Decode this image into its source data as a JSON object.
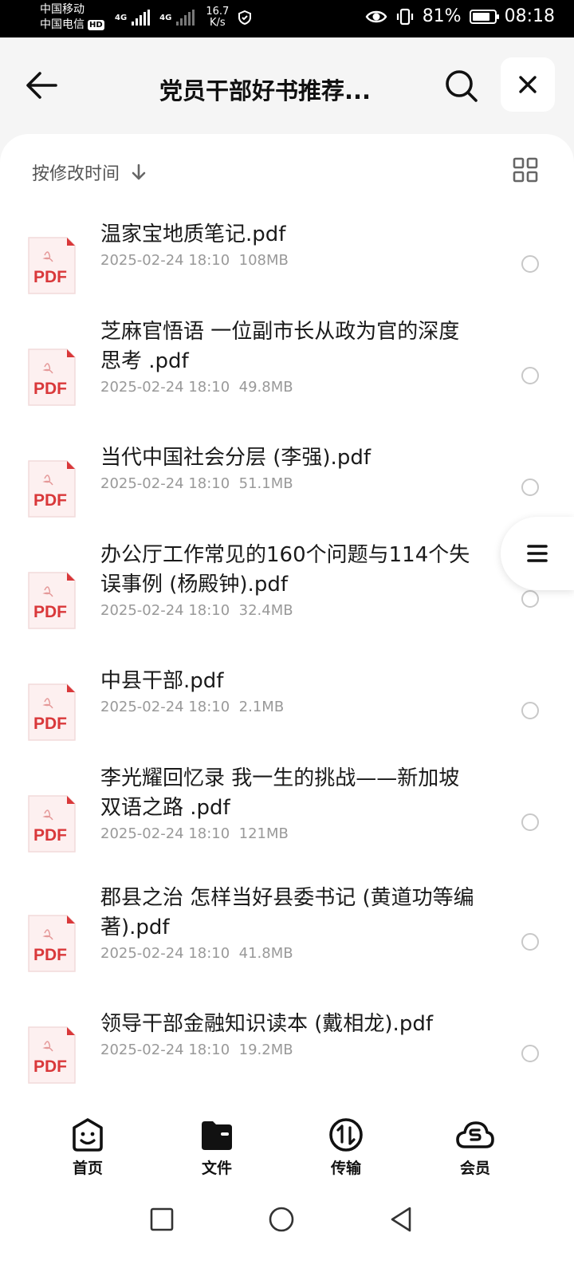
{
  "status_bar": {
    "carrier1": "中国移动",
    "carrier2": "中国电信",
    "hd": "HD",
    "net_type": "4G",
    "net_type2": "4G",
    "speed_value": "16.7",
    "speed_unit": "K/s",
    "battery": "81%",
    "battery_level": 0.81,
    "time": "08:18"
  },
  "header": {
    "title": "党员干部好书推荐..."
  },
  "sort": {
    "label": "按修改时间"
  },
  "files": [
    {
      "name": "温家宝地质笔记.pdf",
      "date": "2025-02-24 18:10",
      "size": "108MB"
    },
    {
      "name": "芝麻官悟语 一位副市长从政为官的深度思考 .pdf",
      "date": "2025-02-24 18:10",
      "size": "49.8MB"
    },
    {
      "name": "当代中国社会分层 (李强).pdf",
      "date": "2025-02-24 18:10",
      "size": "51.1MB"
    },
    {
      "name": "办公厅工作常见的160个问题与114个失误事例 (杨殿钟).pdf",
      "date": "2025-02-24 18:10",
      "size": "32.4MB"
    },
    {
      "name": "中县干部.pdf",
      "date": "2025-02-24 18:10",
      "size": "2.1MB"
    },
    {
      "name": "李光耀回忆录 我一生的挑战——新加坡双语之路 .pdf",
      "date": "2025-02-24 18:10",
      "size": "121MB"
    },
    {
      "name": "郡县之治 怎样当好县委书记 (黄道功等编著).pdf",
      "date": "2025-02-24 18:10",
      "size": "41.8MB"
    },
    {
      "name": "领导干部金融知识读本 (戴相龙).pdf",
      "date": "2025-02-24 18:10",
      "size": "19.2MB"
    }
  ],
  "file_icon_label": "PDF",
  "nav": {
    "home": "首页",
    "files": "文件",
    "transfer": "传输",
    "vip": "会员",
    "active": "files"
  },
  "colors": {
    "pdf_red": "#d9383a",
    "accent": "#111111"
  }
}
